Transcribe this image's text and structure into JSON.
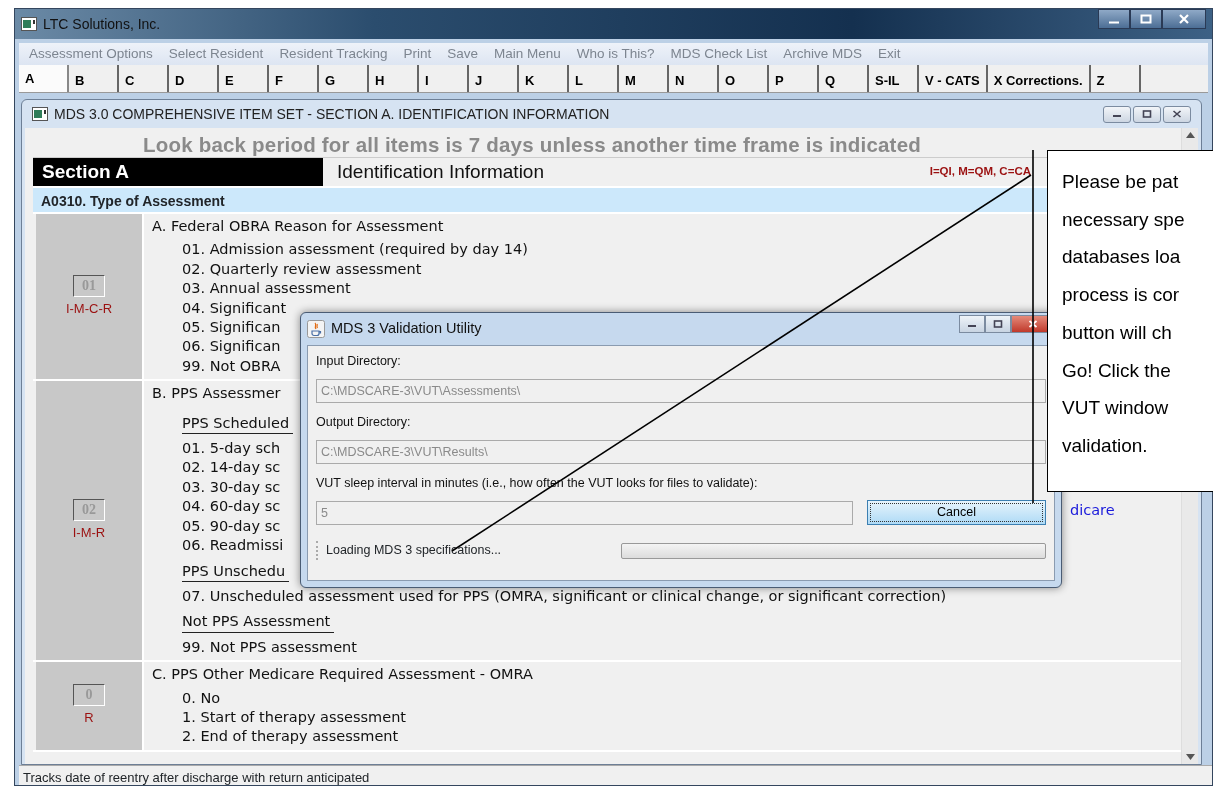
{
  "window": {
    "title": "LTC Solutions, Inc."
  },
  "menu": [
    {
      "label": "Assessment Options",
      "disabled": true
    },
    {
      "label": "Select Resident",
      "disabled": true
    },
    {
      "label": "Resident Tracking",
      "disabled": true
    },
    {
      "label": "Print",
      "disabled": true
    },
    {
      "label": "Save",
      "disabled": true
    },
    {
      "label": "Main Menu",
      "disabled": true
    },
    {
      "label": "Who is This?",
      "disabled": true
    },
    {
      "label": "MDS Check List",
      "disabled": true
    },
    {
      "label": "Archive MDS",
      "disabled": true
    },
    {
      "label": "Exit",
      "disabled": true
    }
  ],
  "tabs": [
    {
      "label": "A",
      "selected": true
    },
    {
      "label": "B",
      "selected": false
    },
    {
      "label": "C",
      "selected": false
    },
    {
      "label": "D",
      "selected": false
    },
    {
      "label": "E",
      "selected": false
    },
    {
      "label": "F",
      "selected": false
    },
    {
      "label": "G",
      "selected": false
    },
    {
      "label": "H",
      "selected": false
    },
    {
      "label": "I",
      "selected": false
    },
    {
      "label": "J",
      "selected": false
    },
    {
      "label": "K",
      "selected": false
    },
    {
      "label": "L",
      "selected": false
    },
    {
      "label": "M",
      "selected": false
    },
    {
      "label": "N",
      "selected": false
    },
    {
      "label": "O",
      "selected": false
    },
    {
      "label": "P",
      "selected": false
    },
    {
      "label": "Q",
      "selected": false
    },
    {
      "label": "S-IL",
      "selected": false
    },
    {
      "label": "V - CATS",
      "selected": false
    },
    {
      "label": "X Corrections.",
      "selected": false
    },
    {
      "label": "Z",
      "selected": false
    }
  ],
  "form_window": {
    "title": "MDS 3.0 COMPREHENSIVE ITEM SET - SECTION A. IDENTIFICATION INFORMATION"
  },
  "lookback": "Look back period for all items is 7 days unless another time frame is indicated",
  "section": {
    "label": "Section A",
    "title": "Identification Information",
    "legend": "I=QI, M=QM, C=CA"
  },
  "item_header": "A0310. Type of Assessment",
  "questions": [
    {
      "code": "01",
      "tags": "I-M-C-R",
      "lines": [
        {
          "kind": "heading",
          "text": "A.  Federal OBRA Reason for Assessment"
        },
        {
          "kind": "option",
          "text": "01.  Admission assessment (required by day 14)"
        },
        {
          "kind": "option",
          "text": "02.  Quarterly review assessment"
        },
        {
          "kind": "option",
          "text": "03.  Annual assessment"
        },
        {
          "kind": "option",
          "text": "04.  Significant"
        },
        {
          "kind": "option",
          "text": "05.  Significan"
        },
        {
          "kind": "option",
          "text": "06.  Significan"
        },
        {
          "kind": "option",
          "text": "99.  Not OBRA"
        }
      ]
    },
    {
      "code": "02",
      "tags": "I-M-R",
      "side_note": "dicare",
      "lines": [
        {
          "kind": "heading",
          "text": "B.  PPS Assessmer"
        },
        {
          "kind": "subheading",
          "text": "PPS Scheduled"
        },
        {
          "kind": "option",
          "text": "01.  5-day sch"
        },
        {
          "kind": "option",
          "text": "02.  14-day sc"
        },
        {
          "kind": "option",
          "text": "03.  30-day sc"
        },
        {
          "kind": "option",
          "text": "04.  60-day sc"
        },
        {
          "kind": "option",
          "text": "05.  90-day sc"
        },
        {
          "kind": "option",
          "text": "06.  Readmissi"
        },
        {
          "kind": "subheading",
          "text": "PPS Unschedu"
        },
        {
          "kind": "option",
          "text": "07.  Unscheduled assessment used for PPS (OMRA, significant or clinical change, or significant correction)"
        },
        {
          "kind": "subheading",
          "text": "Not PPS Assessment"
        },
        {
          "kind": "option",
          "text": "99.  Not PPS assessment"
        }
      ]
    },
    {
      "code": "0",
      "tags": "R",
      "lines": [
        {
          "kind": "heading",
          "text": "C.  PPS Other Medicare Required Assessment - OMRA"
        },
        {
          "kind": "option",
          "text": "0.  No"
        },
        {
          "kind": "option",
          "text": "1.  Start of therapy assessment"
        },
        {
          "kind": "option",
          "text": "2.  End of therapy assessment"
        }
      ]
    }
  ],
  "dialog": {
    "title": "MDS 3 Validation Utility",
    "fields": [
      {
        "label": "Input Directory:",
        "value": "C:\\MDSCARE-3\\VUT\\Assessments\\",
        "disabled": true
      },
      {
        "label": "Output Directory:",
        "value": "C:\\MDSCARE-3\\VUT\\Results\\",
        "disabled": true
      },
      {
        "label": "VUT sleep interval in minutes (i.e., how often the VUT looks for files to validate):",
        "value": "5",
        "disabled": true
      }
    ],
    "button": "Cancel",
    "status": "Loading MDS 3 specifications...",
    "progress": {
      "level": 0
    }
  },
  "callout": {
    "lines": [
      "Please be pat",
      "necessary spe",
      "databases loa",
      "process is cor",
      "button will ch",
      "Go!  Click the",
      "VUT window",
      "validation."
    ]
  },
  "status_bar": "Tracks date of reentry after discharge with return anticipated"
}
